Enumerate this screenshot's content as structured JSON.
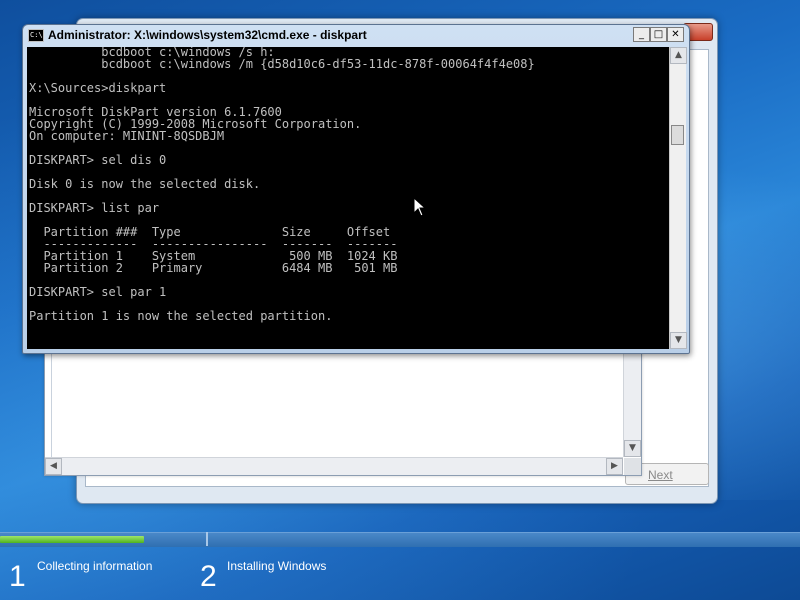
{
  "cmd": {
    "title": "Administrator: X:\\windows\\system32\\cmd.exe - diskpart",
    "icon_text": "C:\\",
    "minimize_glyph": "_",
    "maximize_glyph": "□",
    "close_glyph": "✕",
    "lines": [
      "          bcdboot c:\\windows /s h:",
      "          bcdboot c:\\windows /m {d58d10c6-df53-11dc-878f-00064f4f4e08}",
      "",
      "X:\\Sources>diskpart",
      "",
      "Microsoft DiskPart version 6.1.7600",
      "Copyright (C) 1999-2008 Microsoft Corporation.",
      "On computer: MININT-8QSDBJM",
      "",
      "DISKPART> sel dis 0",
      "",
      "Disk 0 is now the selected disk.",
      "",
      "DISKPART> list par",
      "",
      "  Partition ###  Type              Size     Offset",
      "  -------------  ----------------  -------  -------",
      "  Partition 1    System             500 MB  1024 KB",
      "  Partition 2    Primary           6484 MB   501 MB",
      "",
      "DISKPART> sel par 1",
      "",
      "Partition 1 is now the selected partition."
    ]
  },
  "scroll": {
    "up_arrow": "▲",
    "down_arrow": "▼",
    "left_arrow": "◀",
    "right_arrow": "▶"
  },
  "setup": {
    "next_label": "Next"
  },
  "progress": {
    "fraction": 0.18,
    "steps": [
      {
        "number": "1",
        "label": "Collecting information"
      },
      {
        "number": "2",
        "label": "Installing Windows"
      }
    ]
  },
  "colors": {
    "console_bg": "#000000",
    "console_text": "#c0c0c0",
    "progress_green": "#4fb31f"
  }
}
